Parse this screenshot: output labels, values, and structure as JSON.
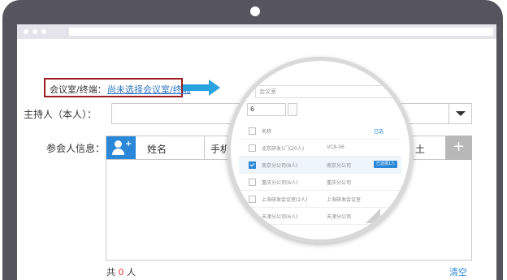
{
  "form": {
    "room_label": "会议室/终端：",
    "room_link": "尚未选择会议室/终端",
    "host_label": "主持人（本人）：",
    "attendee_label": "参会人信息：",
    "col_name": "姓名",
    "col_phone": "手机",
    "col_tail": "土",
    "total_prefix": "共",
    "total_count": "0",
    "total_suffix": "人",
    "clear_label": "清空"
  },
  "magnifier": {
    "search_placeholder": "会议室",
    "input_value": "6",
    "search_button": "",
    "header": {
      "name": "名称",
      "right": "已选"
    },
    "rows": [
      {
        "name": "北京研发1门(20人)",
        "code": "VC8-06",
        "checked": false,
        "tag": ""
      },
      {
        "name": "南京分公司(8人)",
        "code": "南京分公司",
        "checked": true,
        "tag": "已选择1人"
      },
      {
        "name": "重庆分公司(6人)",
        "code": "重庆分公司",
        "checked": false,
        "tag": ""
      },
      {
        "name": "上海研发会议室(2人)",
        "code": "上海研发会议室",
        "checked": false,
        "tag": ""
      },
      {
        "name": "天津分公司(6人)",
        "code": "天津分公司",
        "checked": false,
        "tag": ""
      }
    ]
  },
  "colors": {
    "frame": "#56555e",
    "accent": "#2b88d8",
    "highlight_border": "#9b1c22",
    "arrow": "#2aa2de",
    "count": "#e53935"
  }
}
